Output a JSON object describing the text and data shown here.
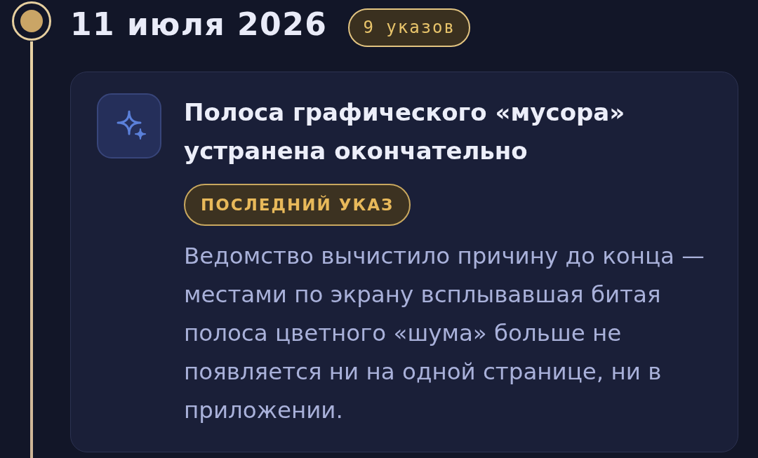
{
  "timeline": {
    "date": "11 июля 2026",
    "count_badge": "9 указов",
    "entries": [
      {
        "title": "Полоса графического «мусора» устранена окончательно",
        "tag": "ПОСЛЕДНИЙ УКАЗ",
        "body": "Ведомство вычистило причину до конца — местами по экрану всплывавшая битая полоса цветного «шума» больше не появляется ни на одной странице, ни в приложении."
      }
    ]
  }
}
